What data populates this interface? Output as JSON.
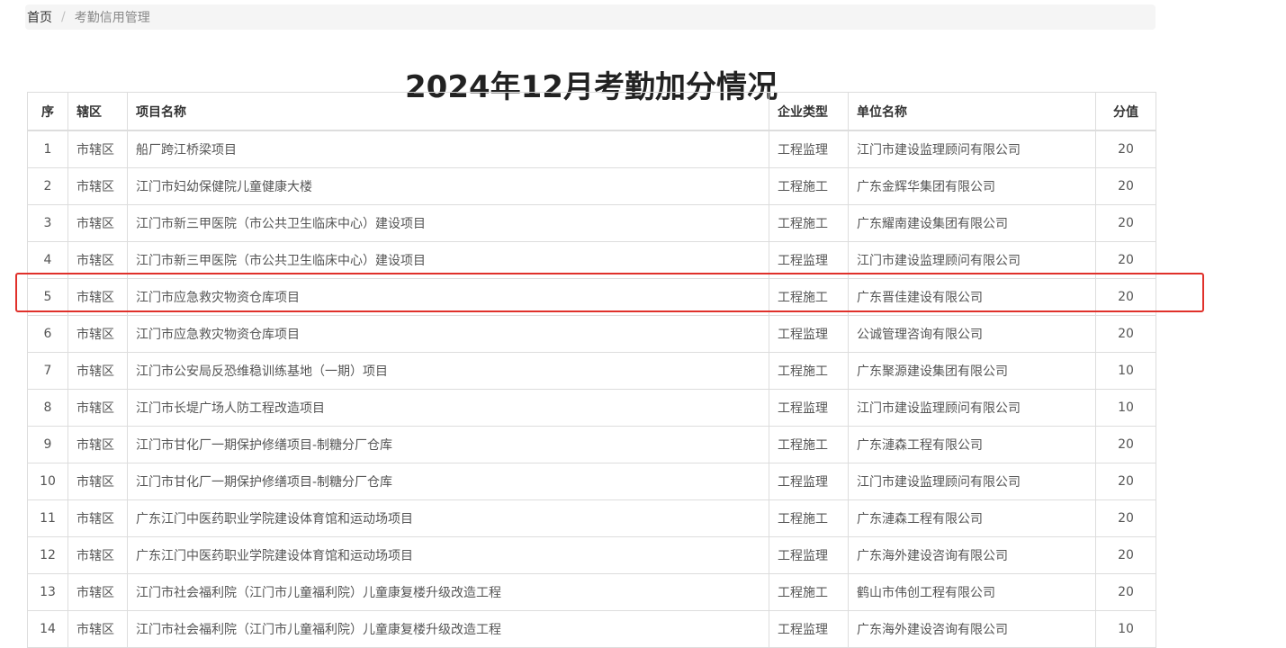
{
  "breadcrumb": {
    "home": "首页",
    "separator": "/",
    "current": "考勤信用管理"
  },
  "title": "2024年12月考勤加分情况",
  "table": {
    "headers": {
      "no": "序",
      "district": "辖区",
      "project": "项目名称",
      "type": "企业类型",
      "company": "单位名称",
      "score": "分值"
    },
    "rows": [
      {
        "no": "1",
        "district": "市辖区",
        "project": "船厂跨江桥梁项目",
        "type": "工程监理",
        "company": "江门市建设监理顾问有限公司",
        "score": "20"
      },
      {
        "no": "2",
        "district": "市辖区",
        "project": "江门市妇幼保健院儿童健康大楼",
        "type": "工程施工",
        "company": "广东金辉华集团有限公司",
        "score": "20"
      },
      {
        "no": "3",
        "district": "市辖区",
        "project": "江门市新三甲医院（市公共卫生临床中心）建设项目",
        "type": "工程施工",
        "company": "广东耀南建设集团有限公司",
        "score": "20"
      },
      {
        "no": "4",
        "district": "市辖区",
        "project": "江门市新三甲医院（市公共卫生临床中心）建设项目",
        "type": "工程监理",
        "company": "江门市建设监理顾问有限公司",
        "score": "20"
      },
      {
        "no": "5",
        "district": "市辖区",
        "project": "江门市应急救灾物资仓库项目",
        "type": "工程施工",
        "company": "广东晋佳建设有限公司",
        "score": "20"
      },
      {
        "no": "6",
        "district": "市辖区",
        "project": "江门市应急救灾物资仓库项目",
        "type": "工程监理",
        "company": "公诚管理咨询有限公司",
        "score": "20"
      },
      {
        "no": "7",
        "district": "市辖区",
        "project": "江门市公安局反恐维稳训练基地（一期）项目",
        "type": "工程施工",
        "company": "广东聚源建设集团有限公司",
        "score": "10"
      },
      {
        "no": "8",
        "district": "市辖区",
        "project": "江门市长堤广场人防工程改造项目",
        "type": "工程监理",
        "company": "江门市建设监理顾问有限公司",
        "score": "10"
      },
      {
        "no": "9",
        "district": "市辖区",
        "project": "江门市甘化厂一期保护修缮项目-制糖分厂仓库",
        "type": "工程施工",
        "company": "广东漣森工程有限公司",
        "score": "20"
      },
      {
        "no": "10",
        "district": "市辖区",
        "project": "江门市甘化厂一期保护修缮项目-制糖分厂仓库",
        "type": "工程监理",
        "company": "江门市建设监理顾问有限公司",
        "score": "20"
      },
      {
        "no": "11",
        "district": "市辖区",
        "project": "广东江门中医药职业学院建设体育馆和运动场项目",
        "type": "工程施工",
        "company": "广东漣森工程有限公司",
        "score": "20"
      },
      {
        "no": "12",
        "district": "市辖区",
        "project": "广东江门中医药职业学院建设体育馆和运动场项目",
        "type": "工程监理",
        "company": "广东海外建设咨询有限公司",
        "score": "20"
      },
      {
        "no": "13",
        "district": "市辖区",
        "project": "江门市社会福利院（江门市儿童福利院）儿童康复楼升级改造工程",
        "type": "工程施工",
        "company": "鹤山市伟创工程有限公司",
        "score": "20"
      },
      {
        "no": "14",
        "district": "市辖区",
        "project": "江门市社会福利院（江门市儿童福利院）儿童康复楼升级改造工程",
        "type": "工程监理",
        "company": "广东海外建设咨询有限公司",
        "score": "10"
      }
    ]
  },
  "highlight": {
    "row_no": "5",
    "color": "#e0302a"
  }
}
